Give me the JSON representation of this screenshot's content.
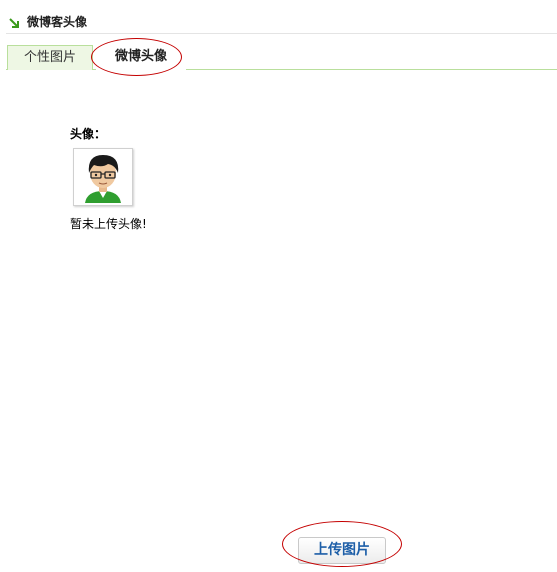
{
  "header": {
    "title": "微博客头像",
    "icon": "green-arrow-icon"
  },
  "tabs": [
    {
      "label": "个性图片",
      "active": false
    },
    {
      "label": "微博头像",
      "active": true
    }
  ],
  "avatar": {
    "label": "头像：",
    "status": "暂未上传头像!",
    "icon": "default-avatar-icon"
  },
  "upload": {
    "label": "上传图片"
  },
  "colors": {
    "tab_bg": "#eef7e4",
    "tab_border": "#b9df9c",
    "highlight": "#c40000",
    "button_text": "#1e5fa8"
  }
}
